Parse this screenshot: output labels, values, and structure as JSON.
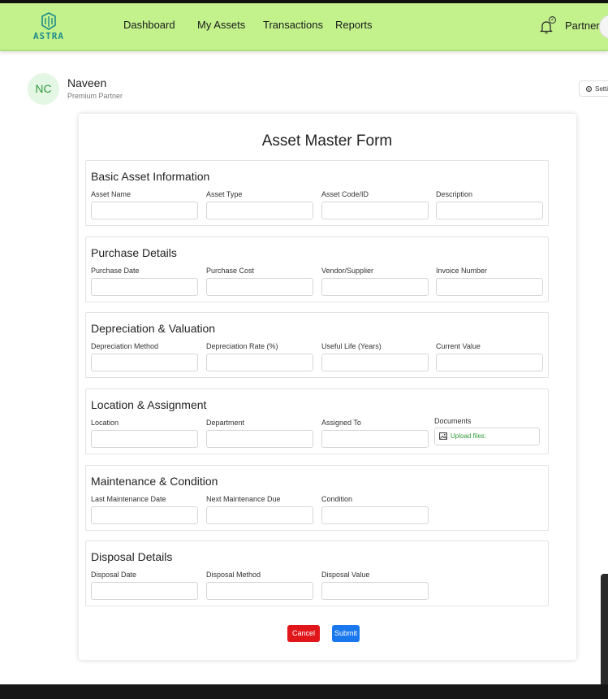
{
  "brand": {
    "name": "ASTRA",
    "accent": "#c3f28c",
    "logo_color": "#1c8a8a"
  },
  "nav": {
    "links": [
      "Dashboard",
      "My Assets",
      "Transactions",
      "Reports"
    ],
    "notification_count": "2",
    "user_label": "Partner"
  },
  "profile": {
    "initials": "NC",
    "name": "Naveen",
    "role": "Premium Partner",
    "settings_label": "Settings"
  },
  "form": {
    "title": "Asset Master Form",
    "sections": [
      {
        "title": "Basic Asset Information",
        "fields": [
          "Asset Name",
          "Asset Type",
          "Asset Code/ID",
          "Description"
        ]
      },
      {
        "title": "Purchase Details",
        "fields": [
          "Purchase Date",
          "Purchase Cost",
          "Vendor/Supplier",
          "Invoice Number"
        ]
      },
      {
        "title": "Depreciation & Valuation",
        "fields": [
          "Depreciation Method",
          "Depreciation Rate (%)",
          "Useful Life (Years)",
          "Current Value"
        ]
      },
      {
        "title": "Location & Assignment",
        "fields": [
          "Location",
          "Department",
          "Assigned To",
          "Documents"
        ],
        "upload_label": "Upload files:"
      },
      {
        "title": "Maintenance & Condition",
        "fields": [
          "Last Maintenance Date",
          "Next Maintenance Due",
          "Condition"
        ]
      },
      {
        "title": "Disposal Details",
        "fields": [
          "Disposal Date",
          "Disposal Method",
          "Disposal Value"
        ]
      }
    ],
    "cancel_label": "Cancel",
    "submit_label": "Submit",
    "cancel_color": "#e0161b",
    "submit_color": "#1a78ee"
  }
}
